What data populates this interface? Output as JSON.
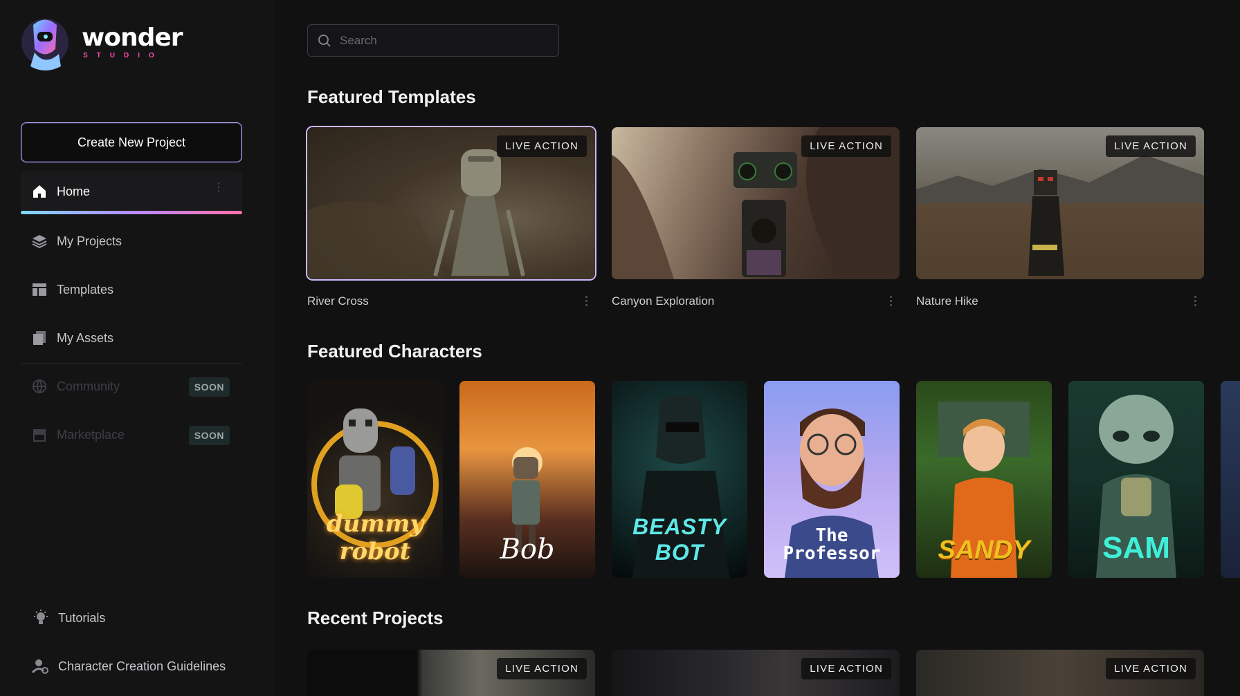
{
  "brand": {
    "name": "wonder",
    "sub": "STUDIO"
  },
  "sidebar": {
    "create_label": "Create New Project",
    "items": [
      {
        "label": "Home",
        "icon": "home-icon"
      },
      {
        "label": "My Projects",
        "icon": "layers-icon"
      },
      {
        "label": "Templates",
        "icon": "layout-icon"
      },
      {
        "label": "My Assets",
        "icon": "assets-icon"
      },
      {
        "label": "Community",
        "icon": "globe-icon",
        "badge": "SOON"
      },
      {
        "label": "Marketplace",
        "icon": "store-icon",
        "badge": "SOON"
      }
    ],
    "bottom": [
      {
        "label": "Tutorials",
        "icon": "lightbulb-icon"
      },
      {
        "label": "Character Creation Guidelines",
        "icon": "user-settings-icon"
      }
    ]
  },
  "search": {
    "placeholder": "Search"
  },
  "sections": {
    "templates": "Featured Templates",
    "characters": "Featured Characters",
    "recent": "Recent Projects"
  },
  "templates": [
    {
      "name": "River Cross",
      "badge": "LIVE ACTION"
    },
    {
      "name": "Canyon Exploration",
      "badge": "LIVE ACTION"
    },
    {
      "name": "Nature Hike",
      "badge": "LIVE ACTION"
    }
  ],
  "characters": [
    {
      "name": "dummy robot"
    },
    {
      "name": "Bob"
    },
    {
      "name": "BEASTY BOT"
    },
    {
      "name": "The Professor"
    },
    {
      "name": "SANDY"
    },
    {
      "name": "SAM"
    }
  ],
  "recent": [
    {
      "badge": "LIVE ACTION"
    },
    {
      "badge": "LIVE ACTION"
    },
    {
      "badge": "LIVE ACTION"
    }
  ],
  "colors": {
    "accent_border": "#c9a4ff",
    "nav_gradient": [
      "#7fd7ff",
      "#b48cff",
      "#ff6fa8"
    ]
  }
}
